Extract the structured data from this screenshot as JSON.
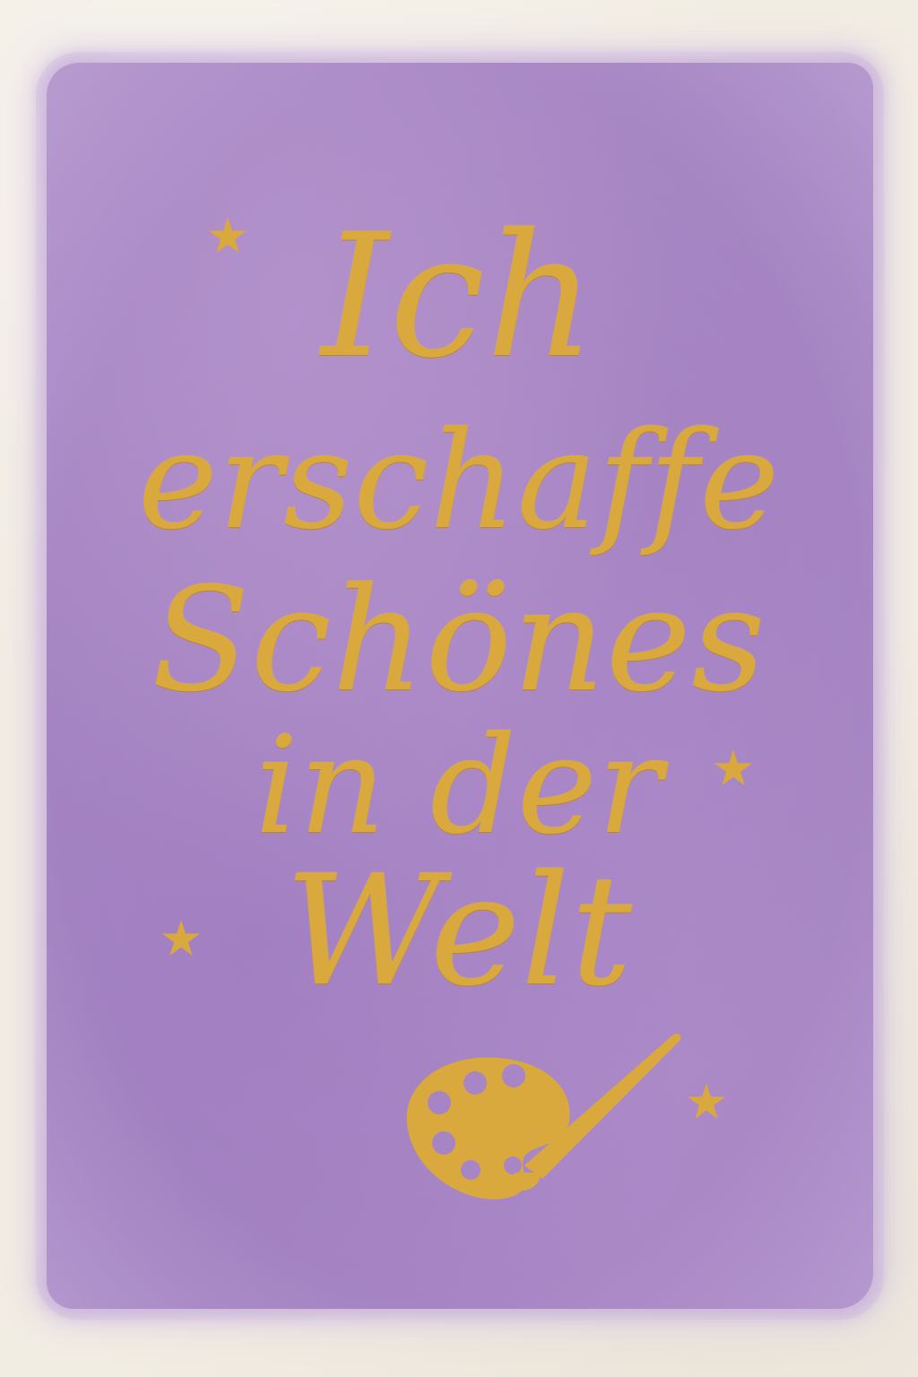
{
  "card": {
    "lines": [
      "Ich",
      "erschaffe",
      "Schönes",
      "in der",
      "Welt"
    ],
    "text_color": "#d9a93e",
    "wash_color": "#a987c7",
    "paper_color": "#f2ede3"
  },
  "decorations": {
    "stars": [
      "star-icon",
      "star-icon",
      "star-icon",
      "star-icon"
    ],
    "palette": "paint-palette-icon"
  }
}
